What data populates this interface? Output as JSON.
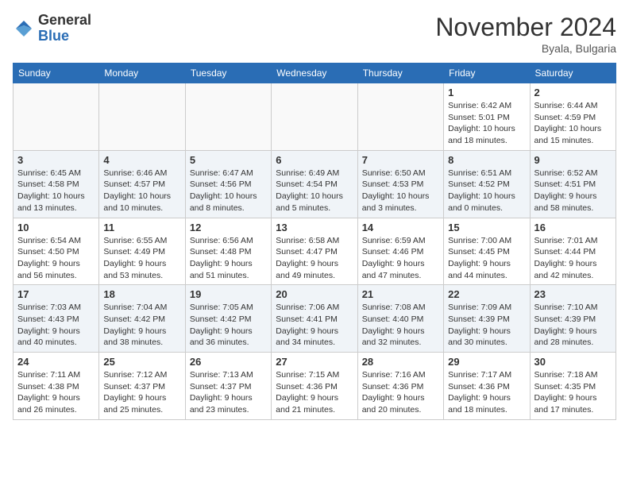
{
  "header": {
    "logo_general": "General",
    "logo_blue": "Blue",
    "month_title": "November 2024",
    "location": "Byala, Bulgaria"
  },
  "days_of_week": [
    "Sunday",
    "Monday",
    "Tuesday",
    "Wednesday",
    "Thursday",
    "Friday",
    "Saturday"
  ],
  "weeks": [
    [
      {
        "day": "",
        "info": ""
      },
      {
        "day": "",
        "info": ""
      },
      {
        "day": "",
        "info": ""
      },
      {
        "day": "",
        "info": ""
      },
      {
        "day": "",
        "info": ""
      },
      {
        "day": "1",
        "info": "Sunrise: 6:42 AM\nSunset: 5:01 PM\nDaylight: 10 hours and 18 minutes."
      },
      {
        "day": "2",
        "info": "Sunrise: 6:44 AM\nSunset: 4:59 PM\nDaylight: 10 hours and 15 minutes."
      }
    ],
    [
      {
        "day": "3",
        "info": "Sunrise: 6:45 AM\nSunset: 4:58 PM\nDaylight: 10 hours and 13 minutes."
      },
      {
        "day": "4",
        "info": "Sunrise: 6:46 AM\nSunset: 4:57 PM\nDaylight: 10 hours and 10 minutes."
      },
      {
        "day": "5",
        "info": "Sunrise: 6:47 AM\nSunset: 4:56 PM\nDaylight: 10 hours and 8 minutes."
      },
      {
        "day": "6",
        "info": "Sunrise: 6:49 AM\nSunset: 4:54 PM\nDaylight: 10 hours and 5 minutes."
      },
      {
        "day": "7",
        "info": "Sunrise: 6:50 AM\nSunset: 4:53 PM\nDaylight: 10 hours and 3 minutes."
      },
      {
        "day": "8",
        "info": "Sunrise: 6:51 AM\nSunset: 4:52 PM\nDaylight: 10 hours and 0 minutes."
      },
      {
        "day": "9",
        "info": "Sunrise: 6:52 AM\nSunset: 4:51 PM\nDaylight: 9 hours and 58 minutes."
      }
    ],
    [
      {
        "day": "10",
        "info": "Sunrise: 6:54 AM\nSunset: 4:50 PM\nDaylight: 9 hours and 56 minutes."
      },
      {
        "day": "11",
        "info": "Sunrise: 6:55 AM\nSunset: 4:49 PM\nDaylight: 9 hours and 53 minutes."
      },
      {
        "day": "12",
        "info": "Sunrise: 6:56 AM\nSunset: 4:48 PM\nDaylight: 9 hours and 51 minutes."
      },
      {
        "day": "13",
        "info": "Sunrise: 6:58 AM\nSunset: 4:47 PM\nDaylight: 9 hours and 49 minutes."
      },
      {
        "day": "14",
        "info": "Sunrise: 6:59 AM\nSunset: 4:46 PM\nDaylight: 9 hours and 47 minutes."
      },
      {
        "day": "15",
        "info": "Sunrise: 7:00 AM\nSunset: 4:45 PM\nDaylight: 9 hours and 44 minutes."
      },
      {
        "day": "16",
        "info": "Sunrise: 7:01 AM\nSunset: 4:44 PM\nDaylight: 9 hours and 42 minutes."
      }
    ],
    [
      {
        "day": "17",
        "info": "Sunrise: 7:03 AM\nSunset: 4:43 PM\nDaylight: 9 hours and 40 minutes."
      },
      {
        "day": "18",
        "info": "Sunrise: 7:04 AM\nSunset: 4:42 PM\nDaylight: 9 hours and 38 minutes."
      },
      {
        "day": "19",
        "info": "Sunrise: 7:05 AM\nSunset: 4:42 PM\nDaylight: 9 hours and 36 minutes."
      },
      {
        "day": "20",
        "info": "Sunrise: 7:06 AM\nSunset: 4:41 PM\nDaylight: 9 hours and 34 minutes."
      },
      {
        "day": "21",
        "info": "Sunrise: 7:08 AM\nSunset: 4:40 PM\nDaylight: 9 hours and 32 minutes."
      },
      {
        "day": "22",
        "info": "Sunrise: 7:09 AM\nSunset: 4:39 PM\nDaylight: 9 hours and 30 minutes."
      },
      {
        "day": "23",
        "info": "Sunrise: 7:10 AM\nSunset: 4:39 PM\nDaylight: 9 hours and 28 minutes."
      }
    ],
    [
      {
        "day": "24",
        "info": "Sunrise: 7:11 AM\nSunset: 4:38 PM\nDaylight: 9 hours and 26 minutes."
      },
      {
        "day": "25",
        "info": "Sunrise: 7:12 AM\nSunset: 4:37 PM\nDaylight: 9 hours and 25 minutes."
      },
      {
        "day": "26",
        "info": "Sunrise: 7:13 AM\nSunset: 4:37 PM\nDaylight: 9 hours and 23 minutes."
      },
      {
        "day": "27",
        "info": "Sunrise: 7:15 AM\nSunset: 4:36 PM\nDaylight: 9 hours and 21 minutes."
      },
      {
        "day": "28",
        "info": "Sunrise: 7:16 AM\nSunset: 4:36 PM\nDaylight: 9 hours and 20 minutes."
      },
      {
        "day": "29",
        "info": "Sunrise: 7:17 AM\nSunset: 4:36 PM\nDaylight: 9 hours and 18 minutes."
      },
      {
        "day": "30",
        "info": "Sunrise: 7:18 AM\nSunset: 4:35 PM\nDaylight: 9 hours and 17 minutes."
      }
    ]
  ]
}
